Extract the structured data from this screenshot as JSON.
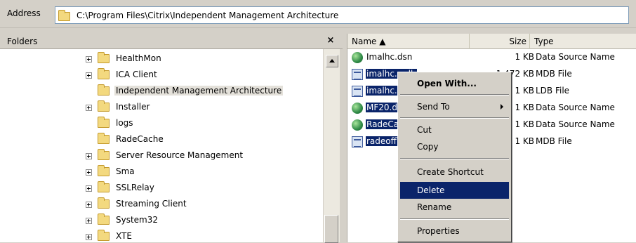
{
  "address_bar": {
    "label": "Address",
    "path": "C:\\Program Files\\Citrix\\Independent Management Architecture"
  },
  "folders_pane": {
    "title": "Folders",
    "close_glyph": "×",
    "items": [
      {
        "label": "HealthMon",
        "expandable": true,
        "selected": false
      },
      {
        "label": "ICA Client",
        "expandable": true,
        "selected": false
      },
      {
        "label": "Independent Management Architecture",
        "expandable": false,
        "selected": true
      },
      {
        "label": "Installer",
        "expandable": true,
        "selected": false
      },
      {
        "label": "logs",
        "expandable": false,
        "selected": false
      },
      {
        "label": "RadeCache",
        "expandable": false,
        "selected": false
      },
      {
        "label": "Server Resource Management",
        "expandable": true,
        "selected": false
      },
      {
        "label": "Sma",
        "expandable": true,
        "selected": false
      },
      {
        "label": "SSLRelay",
        "expandable": true,
        "selected": false
      },
      {
        "label": "Streaming Client",
        "expandable": true,
        "selected": false
      },
      {
        "label": "System32",
        "expandable": true,
        "selected": false
      },
      {
        "label": "XTE",
        "expandable": true,
        "selected": false
      }
    ]
  },
  "file_list": {
    "columns": {
      "name": "Name ▲",
      "size": "Size",
      "type": "Type"
    },
    "rows": [
      {
        "name": "Imalhc.dsn",
        "size": "1 KB",
        "type": "Data Source Name",
        "icon": "dsn-icon",
        "selected": false
      },
      {
        "name": "imalhc.mdb",
        "size": "1,472 KB",
        "type": "MDB File",
        "icon": "mdb-icon",
        "selected": true
      },
      {
        "name": "imalhc.ldb",
        "size": "1 KB",
        "type": "LDB File",
        "icon": "mdb-icon",
        "selected": true
      },
      {
        "name": "MF20.dsn",
        "size": "1 KB",
        "type": "Data Source Name",
        "icon": "dsn-icon",
        "selected": true
      },
      {
        "name": "RadeCache.dsn",
        "size": "1 KB",
        "type": "Data Source Name",
        "icon": "dsn-icon",
        "selected": true
      },
      {
        "name": "radeoffline.mdb",
        "size": "1 KB",
        "type": "MDB File",
        "icon": "mdb-icon",
        "selected": true
      }
    ]
  },
  "context_menu": {
    "open_with": "Open With...",
    "send_to": "Send To",
    "cut": "Cut",
    "copy": "Copy",
    "create_shortcut": "Create Shortcut",
    "delete": "Delete",
    "rename": "Rename",
    "properties": "Properties",
    "highlighted": "delete"
  },
  "colors": {
    "selection": "#0a246a",
    "window_bg": "#d4d0c8"
  }
}
